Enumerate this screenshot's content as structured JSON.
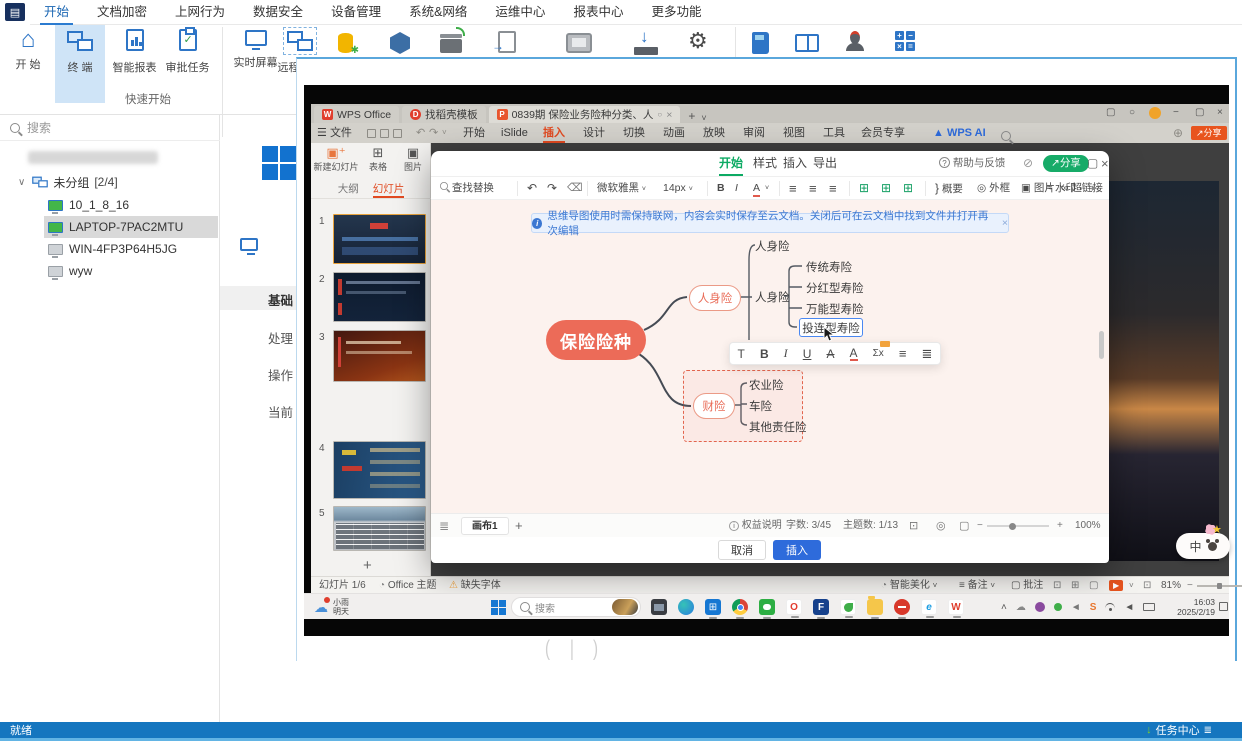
{
  "colors": {
    "app_accent": "#1576bf",
    "wps_orange": "#e14a21",
    "dialog_green": "#0caa63",
    "insert_blue": "#2e6bdb",
    "root_coral": "#ec6b58"
  },
  "icons": {
    "plus": "+",
    "close": "×",
    "minimize": "−",
    "maximize": "▢",
    "chevron_down": "˅",
    "chevron_up": "˄",
    "chevron_right": "▸",
    "dropdown": "∨",
    "undo": "↶",
    "redo": "↷",
    "clear": "⌫",
    "question": "?",
    "warning": "⚠",
    "share_arrow": "↗",
    "home": "⌂",
    "gear": "⚙",
    "cloud": "☁",
    "play": "▶",
    "list": "≡",
    "list2": "≣",
    "grid": "⊞",
    "square": "▢",
    "box": "⊡",
    "target": "◎",
    "brace": "}",
    "image": "▣",
    "link": "∞",
    "watermark": "≈",
    "pen": "✎",
    "sum": "Σx",
    "bold": "B",
    "italic": "I",
    "underline": "U",
    "strike": "A",
    "color_a": "A",
    "text_t": "T",
    "file_menu_icon": "☰",
    "minus": "−",
    "circle": "○",
    "info": "i",
    "down_arrow": "↓",
    "caret_left": "(",
    "caret_right": ")",
    "bar": "|",
    "speaker": "◄"
  },
  "app": {
    "window_menu": [
      "开始",
      "文档加密",
      "上网行为",
      "数据安全",
      "设备管理",
      "系统&网络",
      "运维中心",
      "报表中心",
      "更多功能"
    ],
    "active_menu": "开始",
    "ribbon": {
      "group_title": "快速开始",
      "items": [
        {
          "label": "开 始"
        },
        {
          "label": "终 端"
        },
        {
          "label": "智能报表"
        },
        {
          "label": "审批任务"
        },
        {
          "label": "实时屏幕"
        },
        {
          "label": "远程协助"
        }
      ],
      "extra_icons": [
        "software-package-icon",
        "security-hex-icon",
        "server-network-icon",
        "report-transfer-icon",
        "device-card-icon",
        "download-icon",
        "settings-gear-icon",
        "notebook-icon",
        "manual-icon",
        "support-agent-icon",
        "calculator-icon"
      ]
    },
    "sidebar": {
      "search_placeholder": "搜索",
      "tree": {
        "group_label": "未分组",
        "group_count": "[2/4]",
        "items": [
          {
            "name": "10_1_8_16"
          },
          {
            "name": "LAPTOP-7PAC2MTU"
          },
          {
            "name": "WIN-4FP3P64H5JG"
          },
          {
            "name": "wyw"
          }
        ]
      }
    },
    "background_labels": [
      "基础",
      "处理",
      "操作",
      "当前"
    ],
    "statusbar": {
      "left": "就绪",
      "right": "任务中心"
    }
  },
  "wps": {
    "tabs": [
      {
        "label": "WPS Office",
        "icon": "W"
      },
      {
        "label": "找稻壳模板",
        "icon": "D"
      },
      {
        "label": "0839期 保险业务险种分类、人",
        "icon": "P"
      }
    ],
    "file_menu": "文件",
    "menu_items": [
      "开始",
      "iSlide",
      "插入",
      "设计",
      "切换",
      "动画",
      "放映",
      "审阅",
      "视图",
      "工具",
      "会员专享"
    ],
    "active_menu_item": "插入",
    "ai_label": "WPS AI",
    "share_label": "分享",
    "slide_panel": {
      "new_slide": "新建幻灯片",
      "table": "表格",
      "image": "图片",
      "tabs": [
        "大纲",
        "幻灯片"
      ],
      "active_tab": "幻灯片",
      "slide_numbers": [
        "1",
        "2",
        "3",
        "4",
        "5"
      ]
    },
    "statusbar": {
      "slide_indicator": "幻灯片 1/6",
      "theme": "Office 主题",
      "missing_font": "缺失字体",
      "beautify": "智能美化",
      "notes": "备注",
      "comments": "批注",
      "zoom": "81%"
    }
  },
  "dialog": {
    "tabs": [
      "开始",
      "样式",
      "插入",
      "导出"
    ],
    "active_tab": "开始",
    "help": "帮助与反馈",
    "share": "分享",
    "toolbar": {
      "find_replace": "查找替换",
      "font_name": "微软雅黑",
      "font_size": "14px",
      "outline": "概要",
      "frame": "外框",
      "image": "图片",
      "hyperlink": "超链接",
      "watermark": "水印"
    },
    "banner": "思维导图使用时需保持联网，内容会实时保存至云文档。关闭后可在云文档中找到文件并打开再次编辑",
    "mindmap": {
      "root": "保险险种",
      "branch1": {
        "label": "人身险",
        "children": [
          {
            "label": "人身险"
          },
          {
            "label": "人身险",
            "children": [
              "传统寿险",
              "分红型寿险",
              "万能型寿险",
              "投连型寿险"
            ]
          }
        ],
        "selected_node": "投连型寿险"
      },
      "branch2": {
        "label": "财险",
        "children": [
          "农业险",
          "车险",
          "其他责任险"
        ],
        "framed": true
      }
    },
    "footer": {
      "canvas_tab": "画布1",
      "rights": "权益说明",
      "words_label": "字数:",
      "words_value": "3/45",
      "topics_label": "主题数:",
      "topics_value": "1/13",
      "zoom": "100%"
    },
    "cancel": "取消",
    "insert": "插入"
  },
  "taskbar": {
    "weather_line1": "小雨",
    "weather_line2": "明天",
    "search_placeholder": "搜索",
    "time": "16:03",
    "date": "2025/2/19",
    "app_icons": [
      "explorer-icon",
      "edge-icon",
      "store-icon",
      "chrome-icon",
      "wechat-icon",
      "opera-icon",
      "f-app-icon",
      "green-app-icon",
      "folder-icon",
      "blocked-icon",
      "ie-icon",
      "wps-icon"
    ],
    "tray_icons": [
      "chevron-up-icon",
      "cloud-icon",
      "purple-app-icon",
      "green-status-icon",
      "audio-icon",
      "s-app-icon",
      "wifi-icon",
      "volume-icon",
      "battery-icon"
    ]
  },
  "ime": {
    "label": "中"
  }
}
